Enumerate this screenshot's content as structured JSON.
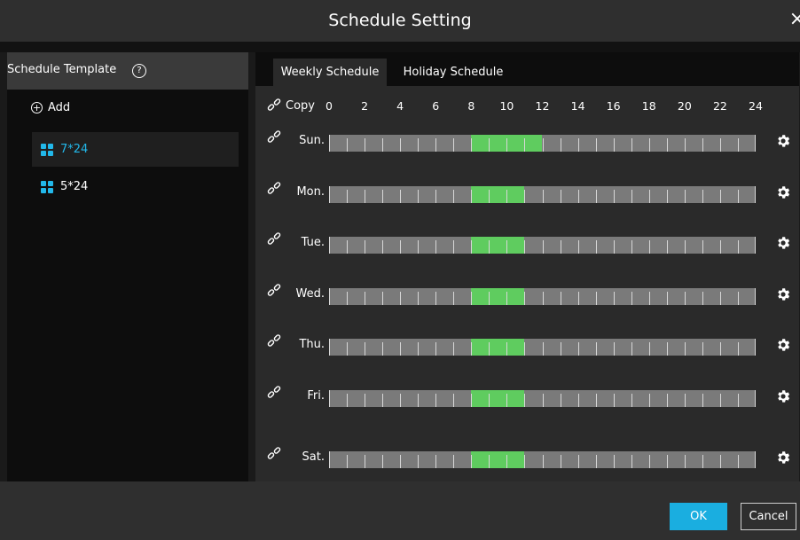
{
  "dialog": {
    "title": "Schedule Setting",
    "close_label": "×"
  },
  "sidebar": {
    "header": "Schedule Template",
    "add_label": "Add",
    "templates": [
      {
        "label": "7*24",
        "selected": true
      },
      {
        "label": "5*24",
        "selected": false
      }
    ]
  },
  "tabs": [
    {
      "label": "Weekly Schedule",
      "active": true
    },
    {
      "label": "Holiday Schedule",
      "active": false
    }
  ],
  "schedule": {
    "copy_label": "Copy",
    "hour_ticks": [
      "0",
      "2",
      "4",
      "6",
      "8",
      "10",
      "12",
      "14",
      "16",
      "18",
      "20",
      "22",
      "24"
    ],
    "days": [
      {
        "label": "Sun.",
        "active_hours": [
          [
            8,
            12
          ]
        ]
      },
      {
        "label": "Mon.",
        "active_hours": [
          [
            8,
            11
          ]
        ]
      },
      {
        "label": "Tue.",
        "active_hours": [
          [
            8,
            11
          ]
        ]
      },
      {
        "label": "Wed.",
        "active_hours": [
          [
            8,
            11
          ]
        ]
      },
      {
        "label": "Thu.",
        "active_hours": [
          [
            8,
            11
          ]
        ]
      },
      {
        "label": "Fri.",
        "active_hours": [
          [
            8,
            11
          ]
        ]
      },
      {
        "label": "Sat.",
        "active_hours": [
          [
            8,
            11
          ]
        ]
      }
    ],
    "colors": {
      "active": "#5fcc5f",
      "inactive": "#7a7a7a",
      "accent": "#22b8ea"
    }
  },
  "footer": {
    "ok_label": "OK",
    "cancel_label": "Cancel"
  }
}
